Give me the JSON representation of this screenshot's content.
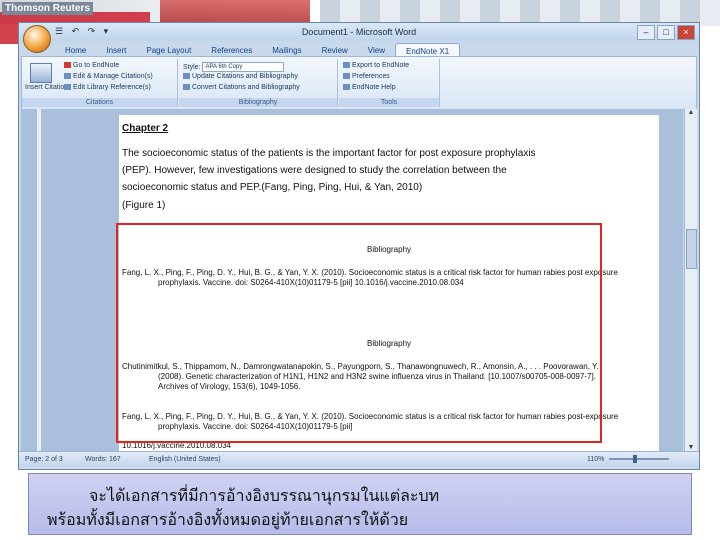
{
  "banner": {
    "brand": "Thomson Reuters"
  },
  "window": {
    "title": "Document1 - Microsoft Word",
    "quick_access": "☰ ↶ ↷ ▾"
  },
  "tabs": [
    "Home",
    "Insert",
    "Page Layout",
    "References",
    "Mailings",
    "Review",
    "View",
    "EndNote X1"
  ],
  "ribbon": {
    "citations": {
      "label": "Citations",
      "insert_citation": "Insert Citation",
      "go_to_endnote": "Go to EndNote",
      "edit_manage": "Edit & Manage Citation(s)",
      "edit_library": "Edit Library Reference(s)"
    },
    "bibliography": {
      "label": "Bibliography",
      "style_label": "Style:",
      "style_value": "APA 6th Copy",
      "update": "Update Citations and Bibliography",
      "convert": "Convert Citations and Bibliography"
    },
    "tools": {
      "label": "Tools",
      "export": "Export to EndNote",
      "preferences": "Preferences",
      "help": "EndNote Help"
    }
  },
  "document": {
    "chapter": "Chapter 2",
    "paragraph": "The socioeconomic status of the patients is the important factor for post exposure prophylaxis (PEP). However, few investigations were designed to study the correlation between the socioeconomic status and PEP.(Fang, Ping, Ping, Hui, & Yan, 2010)",
    "figure": "(Figure 1)",
    "bibliography_1": {
      "title": "Bibliography",
      "entries": [
        "Fang, L. X., Ping, F., Ping, D. Y., Hui, B. G., & Yan, Y. X. (2010). Socioeconomic status is a critical risk factor for human rabies post exposure prophylaxis. Vaccine. doi: S0264-410X(10)01179-5 [pii] 10.1016/j.vaccine.2010.08.034"
      ]
    },
    "bibliography_2": {
      "title": "Bibliography",
      "entries": [
        "Chutinimitkul, S., Thippamom, N., Damrongwatanapokin, S., Payungporn, S., Thanawongnuwech, R., Amonsin, A., . . . Poovorawan, Y. (2008). Genetic characterization of H1N1, H1N2 and H3N2 swine influenza virus in Thailand. [10.1007/s00705-008-0097-7]. Archives of Virology, 153(6), 1049-1056.",
        "Fang, L. X., Ping, F., Ping, D. Y., Hui, B. G., & Yan, Y. X. (2010). Socioeconomic status is a critical risk factor for human rabies post-exposure prophylaxis. Vaccine. doi: S0264-410X(10)01179-5 [pii]",
        "10.1016/j.vaccine.2010.08.034"
      ]
    }
  },
  "status": {
    "page": "Page: 2 of 3",
    "words": "Words: 167",
    "language": "English (United States)",
    "zoom": "110%"
  },
  "caption": {
    "line1": "จะได้เอกสารที่มีการอ้างอิงบรรณานุกรมในแต่ละบท",
    "line2": "พร้อมทั้งมีเอกสารอ้างอิงทั้งหมดอยู่ท้ายเอกสารให้ด้วย"
  }
}
